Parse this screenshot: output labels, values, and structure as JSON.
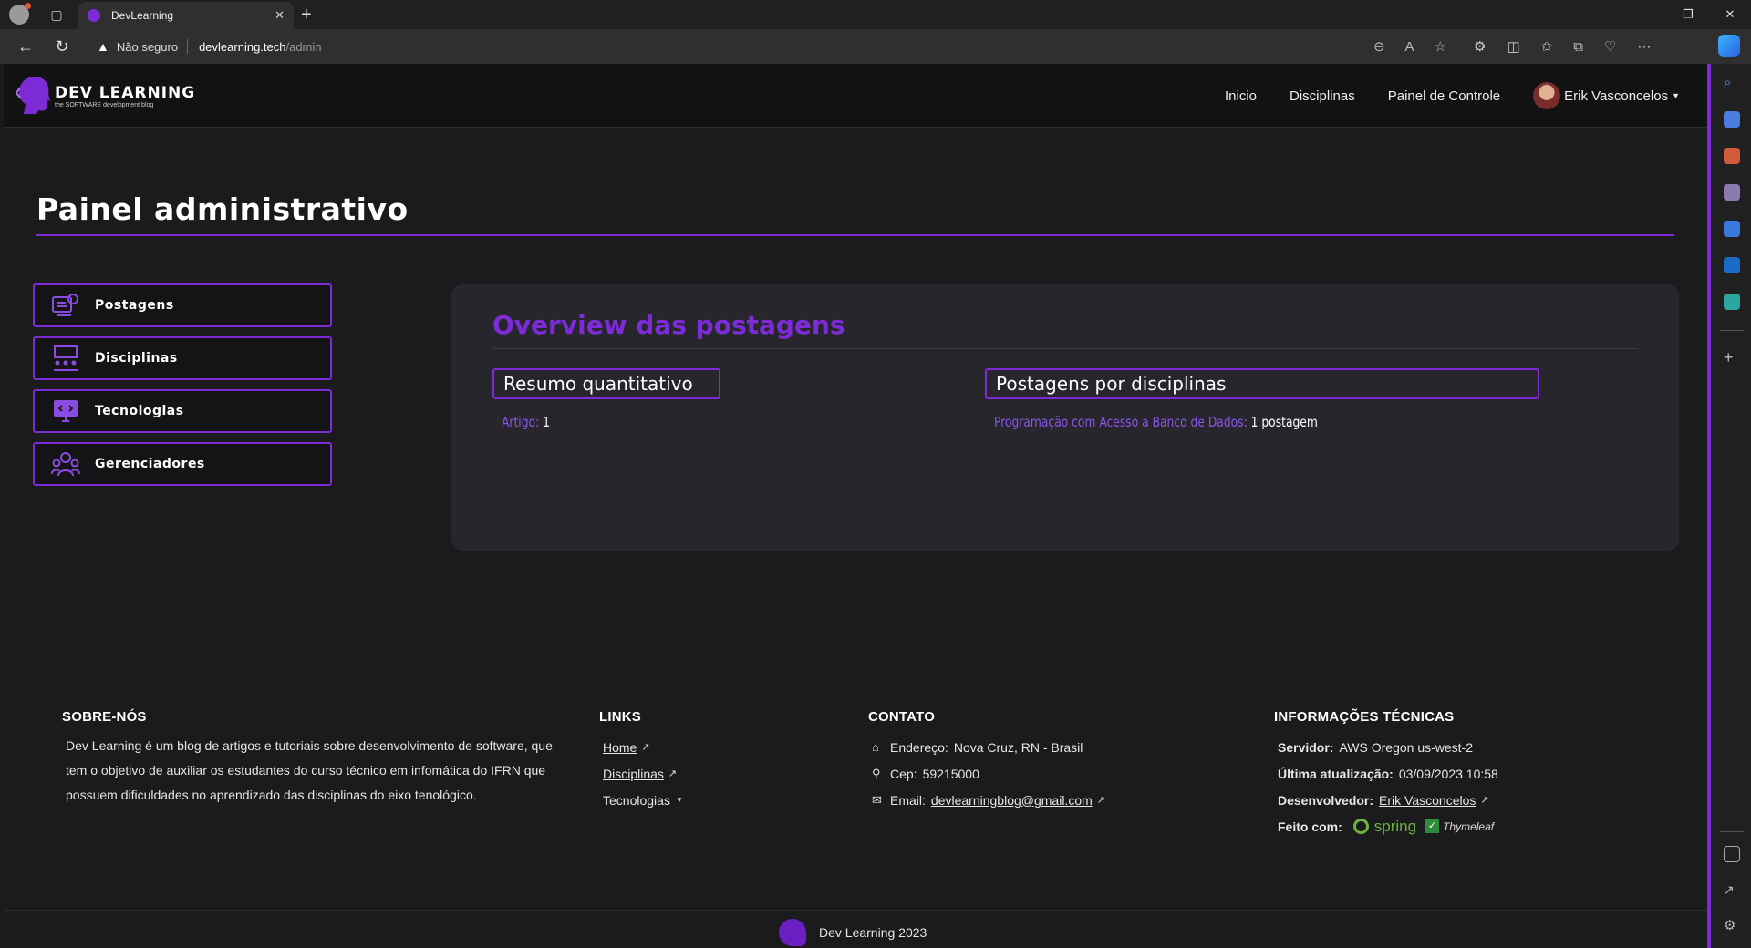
{
  "browser": {
    "tab_title": "DevLearning",
    "security_label": "Não seguro",
    "url_host": "devlearning.tech",
    "url_path": "/admin"
  },
  "header": {
    "logo_title": "DEV LEARNING",
    "logo_subtitle": "the SOFTWARE development blog",
    "nav": {
      "inicio": "Inicio",
      "disciplinas": "Disciplinas",
      "painel": "Painel de Controle"
    },
    "user_name": "Erik Vasconcelos"
  },
  "page": {
    "title": "Painel administrativo"
  },
  "side_menu": {
    "postagens": "Postagens",
    "disciplinas": "Disciplinas",
    "tecnologias": "Tecnologias",
    "gerenciadores": "Gerenciadores"
  },
  "overview": {
    "title": "Overview das postagens",
    "resumo_title": "Resumo quantitativo",
    "resumo_key": "Artigo:",
    "resumo_value": "1",
    "disciplinas_title": "Postagens por disciplinas",
    "disciplina_key": "Programação com Acesso a Banco de Dados:",
    "disciplina_value": "1 postagem"
  },
  "footer": {
    "sobre": {
      "heading": "SOBRE-NÓS",
      "text": "Dev Learning é um blog de artigos e tutoriais sobre desenvolvimento de software, que tem o objetivo de auxiliar os estudantes do curso técnico em infomática do IFRN que possuem dificuldades no aprendizado das disciplinas do eixo tenológico."
    },
    "links": {
      "heading": "LINKS",
      "home": "Home",
      "disciplinas": "Disciplinas",
      "tecnologias": "Tecnologias"
    },
    "contato": {
      "heading": "CONTATO",
      "endereco_label": "Endereço:",
      "endereco": "Nova Cruz, RN - Brasil",
      "cep_label": "Cep:",
      "cep": "59215000",
      "email_label": "Email:",
      "email": "devlearningblog@gmail.com"
    },
    "tecnicas": {
      "heading": "INFORMAÇÕES TÉCNICAS",
      "servidor_label": "Servidor:",
      "servidor": "AWS Oregon us-west-2",
      "atualizacao_label": "Última atualização:",
      "atualizacao": "03/09/2023 10:58",
      "dev_label": "Desenvolvedor:",
      "dev": "Erik Vasconcelos",
      "feito_label": "Feito com:",
      "spring": "spring",
      "thymeleaf": "Thymeleaf"
    },
    "copyright": "Dev Learning 2023"
  },
  "colors": {
    "accent": "#7c2bd6",
    "background": "#1b1b1d",
    "card": "#26262c"
  }
}
